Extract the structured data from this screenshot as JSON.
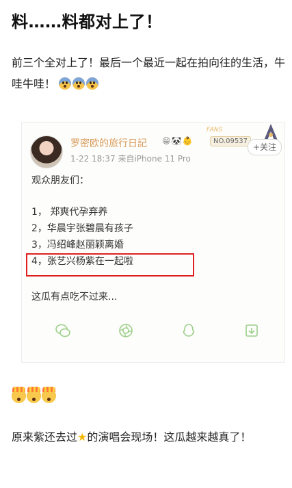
{
  "article": {
    "title": "料……料都对上了！",
    "paragraph1": "前三个全对上了！最后一个最近一起在拍向往的生活，牛哇牛哇！",
    "paragraph2_before": "原来紫还去过",
    "paragraph2_after": "的演唱会现场！这瓜越来越真了！"
  },
  "post": {
    "username": "罗密欧的旅行日記",
    "meta": "1-22 18:37  来自iPhone 11 Pro",
    "fans_label": "FANS",
    "fans_number": "NO.09537",
    "follow_label": "+关注",
    "greeting": "观众朋友们：",
    "items": [
      "1，  郑爽代孕弃养",
      "2，华晨宇张碧晨有孩子",
      "3，冯绍峰赵丽颖离婚",
      "4，张艺兴杨紫在一起啦"
    ],
    "ending": "这瓜有点吃不过来..."
  },
  "colors": {
    "username": "#d89a5a",
    "highlight_border": "#e02020",
    "icon_green": "#9ccf8a"
  },
  "icons": [
    "wechat-icon",
    "moments-icon",
    "qq-icon",
    "share-icon"
  ]
}
